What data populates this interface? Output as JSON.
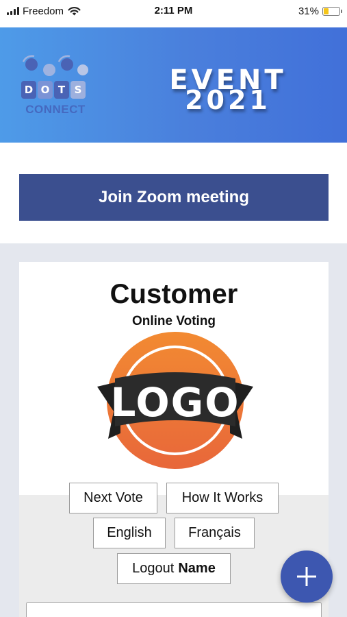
{
  "status_bar": {
    "carrier": "Freedom",
    "time": "2:11 PM",
    "battery_percent": "31%",
    "battery_level": 0.31,
    "icons": [
      "signal-icon",
      "wifi-icon",
      "battery-icon"
    ]
  },
  "banner": {
    "logo_letters": [
      "D",
      "O",
      "T",
      "S"
    ],
    "logo_text": "CONNECT",
    "event_word": "EVENT",
    "event_year": "2021",
    "colors": {
      "gradient_start": "#4e9be8",
      "gradient_end": "#4170d9"
    }
  },
  "zoom": {
    "label": "Join Zoom meeting",
    "color": "#3b4f8f"
  },
  "card": {
    "title": "Customer",
    "subtitle": "Online Voting",
    "logo_label": "LOGO",
    "logo_colors": {
      "circle": "#ee7a33",
      "ribbon": "#2b2b2b"
    }
  },
  "menu": {
    "next_vote": "Next Vote",
    "how_it_works": "How It Works",
    "english": "English",
    "francais": "Français",
    "logout_prefix": "Logout",
    "logout_name": "Name"
  },
  "fab": {
    "icon": "plus-icon",
    "color": "#3d57b0"
  }
}
